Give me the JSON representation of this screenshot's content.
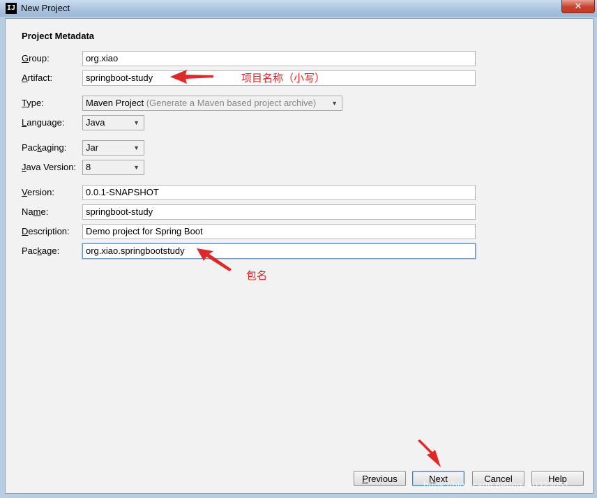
{
  "window": {
    "title": "New Project",
    "app_icon": "IJ",
    "close_glyph": "✕"
  },
  "section_title": "Project Metadata",
  "fields": {
    "group": {
      "label": "Group:",
      "mnemonic": "G",
      "rest": "roup:",
      "value": "org.xiao"
    },
    "artifact": {
      "label": "Artifact:",
      "mnemonic": "A",
      "rest": "rtifact:",
      "value": "springboot-study"
    },
    "type": {
      "label": "Type:",
      "mnemonic": "T",
      "rest": "ype:",
      "value": "Maven Project",
      "hint": "(Generate a Maven based project archive)"
    },
    "language": {
      "label": "Language:",
      "mnemonic": "L",
      "rest": "anguage:",
      "value": "Java"
    },
    "packaging": {
      "label": "Packaging:",
      "pre": "Pac",
      "mnemonic": "k",
      "rest": "aging:",
      "value": "Jar"
    },
    "java_version": {
      "label": "Java Version:",
      "mnemonic": "J",
      "rest": "ava Version:",
      "value": "8"
    },
    "version": {
      "label": "Version:",
      "mnemonic": "V",
      "rest": "ersion:",
      "value": "0.0.1-SNAPSHOT"
    },
    "name": {
      "label": "Name:",
      "pre": "Na",
      "mnemonic": "m",
      "rest": "e:",
      "value": "springboot-study"
    },
    "description": {
      "label": "Description:",
      "mnemonic": "D",
      "rest": "escription:",
      "value": "Demo project for Spring Boot"
    },
    "package": {
      "label": "Package:",
      "pre": "Pac",
      "mnemonic": "k",
      "rest": "age:",
      "value": "org.xiao.springbootstudy"
    }
  },
  "annotations": {
    "artifact_note": "项目名称（小写）",
    "package_note": "包名"
  },
  "buttons": {
    "previous": {
      "mnemonic": "P",
      "rest": "revious"
    },
    "next": {
      "mnemonic": "N",
      "rest": "ext"
    },
    "cancel": {
      "label": "Cancel"
    },
    "help": {
      "label": "Help"
    }
  },
  "watermark": "https://blog.csdn.net/qq_40323051",
  "colors": {
    "annotation": "#e02828",
    "dialog_bg": "#f2f2f2",
    "title_bar": "#a9c3de"
  }
}
